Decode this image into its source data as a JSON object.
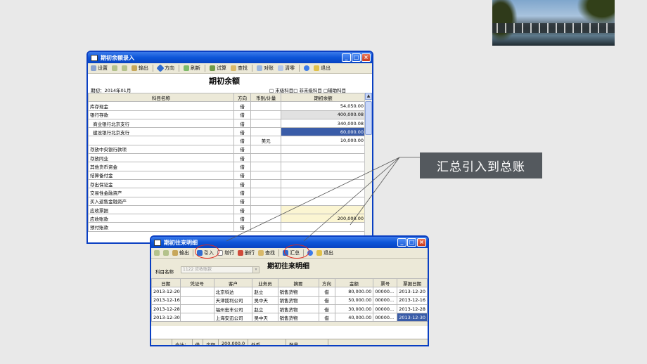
{
  "top_window": {
    "title": "期初余额录入",
    "toolbar": [
      "设置",
      "输出",
      "方向",
      "刷新",
      "试算",
      "查找",
      "对账",
      "清零",
      "退出"
    ],
    "heading": "期初余额",
    "period_label": "期初：2014年01月",
    "legend": "□ 末级科目□ 非末级科目 □辅助科目",
    "columns": [
      "科目名称",
      "方向",
      "币别/计量",
      "期初余额"
    ],
    "rows": [
      {
        "name": "库存现金",
        "dir": "借",
        "cur": "",
        "amt": "54,050.00",
        "style": ""
      },
      {
        "name": "银行存款",
        "dir": "借",
        "cur": "",
        "amt": "400,000.08",
        "style": "gray"
      },
      {
        "name": "  商业银行北京支行",
        "dir": "借",
        "cur": "",
        "amt": "340,000.08",
        "style": ""
      },
      {
        "name": "  建设银行北京支行",
        "dir": "借",
        "cur": "",
        "amt": "60,000.00",
        "style": "sel"
      },
      {
        "name": "",
        "dir": "借",
        "cur": "美元",
        "amt": "10,000.00",
        "style": ""
      },
      {
        "name": "存放中央银行款项",
        "dir": "借",
        "cur": "",
        "amt": "",
        "style": ""
      },
      {
        "name": "存放同业",
        "dir": "借",
        "cur": "",
        "amt": "",
        "style": ""
      },
      {
        "name": "其他货币资金",
        "dir": "借",
        "cur": "",
        "amt": "",
        "style": ""
      },
      {
        "name": "结算备付金",
        "dir": "借",
        "cur": "",
        "amt": "",
        "style": ""
      },
      {
        "name": "存出保证金",
        "dir": "借",
        "cur": "",
        "amt": "",
        "style": ""
      },
      {
        "name": "交易性金融资产",
        "dir": "借",
        "cur": "",
        "amt": "",
        "style": ""
      },
      {
        "name": "买入返售金融资产",
        "dir": "借",
        "cur": "",
        "amt": "",
        "style": ""
      },
      {
        "name": "应收票据",
        "dir": "借",
        "cur": "",
        "amt": "",
        "style": "yel"
      },
      {
        "name": "应收账款",
        "dir": "借",
        "cur": "",
        "amt": "200,000.00",
        "style": "yel"
      },
      {
        "name": "预付账款",
        "dir": "借",
        "cur": "",
        "amt": "",
        "style": ""
      }
    ]
  },
  "bottom_window": {
    "title": "期初往来明细",
    "toolbar": [
      "输出",
      "引入",
      "增行",
      "删行",
      "查找",
      "汇总",
      "退出"
    ],
    "heading": "期初往来明细",
    "subject_label": "科目名称",
    "subject_value": "1122 应收账款",
    "columns": [
      "日期",
      "凭证号",
      "客户",
      "业务员",
      "摘要",
      "方向",
      "金额",
      "票号",
      "票据日期"
    ],
    "rows": [
      [
        "2013-12-20",
        "",
        "北京科达",
        "赵立",
        "销售货物",
        "借",
        "80,000.00",
        "00000...",
        "2013-12-20"
      ],
      [
        "2013-12-16",
        "",
        "天津揽利公司",
        "吴中天",
        "销售货物",
        "借",
        "50,000.00",
        "00000...",
        "2013-12-16"
      ],
      [
        "2013-12-28",
        "",
        "福州宏丰公司",
        "赵立",
        "销售货物",
        "借",
        "30,000.00",
        "00000...",
        "2013-12-28"
      ],
      [
        "2013-12-30",
        "",
        "上海安迅公司",
        "吴中天",
        "销售货物",
        "借",
        "40,000.00",
        "00000...",
        "2013-12-30"
      ]
    ],
    "status": [
      "合计：",
      "借",
      "金额",
      "200,000.0",
      "外币",
      "数量"
    ]
  },
  "callout_text": "汇总引入到总账"
}
